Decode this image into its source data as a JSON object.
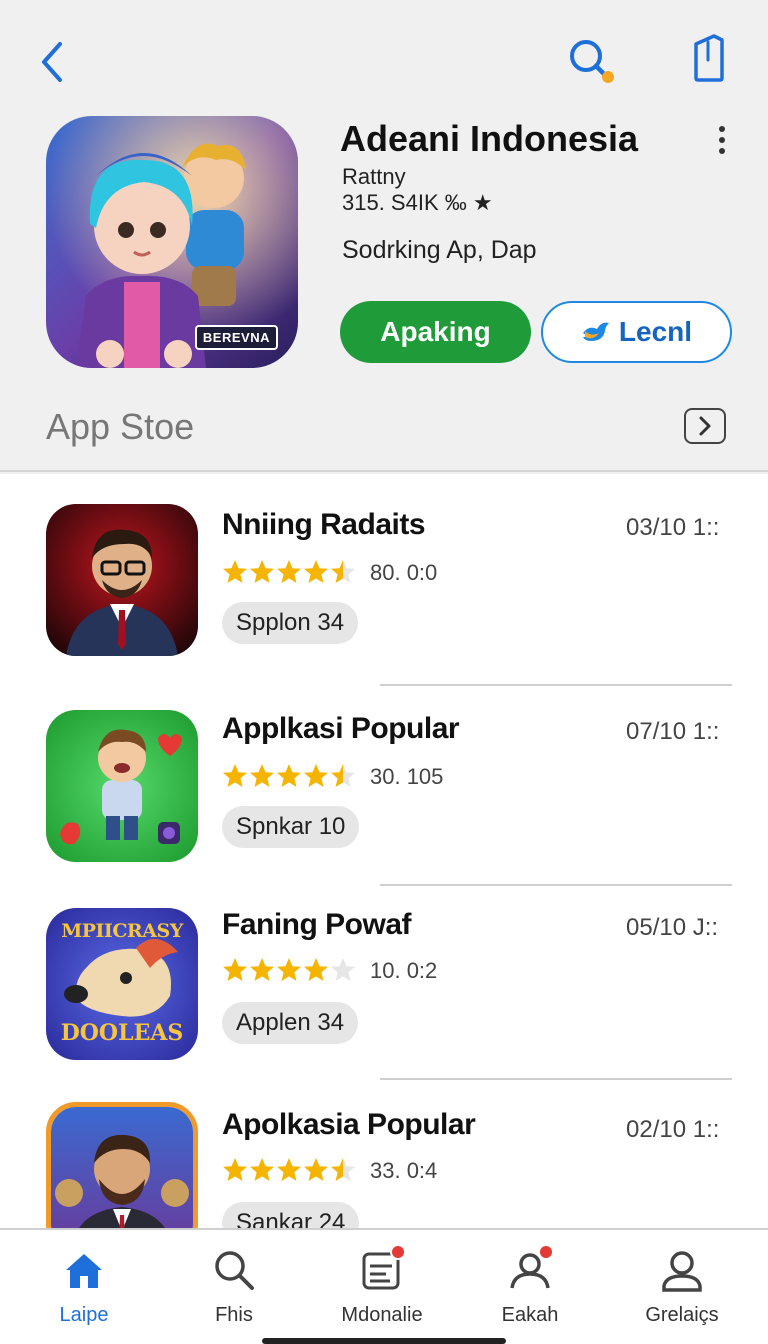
{
  "header": {
    "back_icon": "chevron-left-icon",
    "search_icon": "search-icon",
    "share_icon": "share-icon"
  },
  "app": {
    "title": "Adeani Indonesia",
    "icon_badge": "BEREVNA",
    "rating_label": "Rattny",
    "rating_value": "315. S4IK ‰ ★",
    "subtitle": "Sodrking Ap, Dap",
    "primary_button": "Apaking",
    "secondary_button": "Lecnl",
    "accent_green": "#1f9b3a",
    "accent_blue": "#1e88e5"
  },
  "section": {
    "title": "App Stoe",
    "arrow_icon": "chevron-right-icon"
  },
  "list": [
    {
      "title": "Nniing Radaits",
      "date": "03/10 1::",
      "rating": "80. 0:0",
      "stars": 4.5,
      "tag": "Spplon 34"
    },
    {
      "title": "Applkasi Popular",
      "date": "07/10 1::",
      "rating": "30. 105",
      "stars": 4.5,
      "tag": "Spnkar 10"
    },
    {
      "title": "Faning Powaf",
      "date": "05/10 J::",
      "rating": "10. 0:2",
      "stars": 4,
      "tag": "Applen 34",
      "icon_text_top": "MPIICRASY",
      "icon_text_bottom": "DOOLEAS"
    },
    {
      "title": "Apolkasia Popular",
      "date": "02/10 1::",
      "rating": "33. 0:4",
      "stars": 4.5,
      "tag": "Sankar 24"
    }
  ],
  "bottom_nav": [
    {
      "label": "Laipe",
      "icon": "home-icon",
      "active": true
    },
    {
      "label": "Fhis",
      "icon": "search-icon",
      "active": false
    },
    {
      "label": "Mdonalie",
      "icon": "news-icon",
      "active": false,
      "badge": "2"
    },
    {
      "label": "Eakah",
      "icon": "profile-alert-icon",
      "active": false
    },
    {
      "label": "Grelaiçs",
      "icon": "person-icon",
      "active": false
    }
  ]
}
